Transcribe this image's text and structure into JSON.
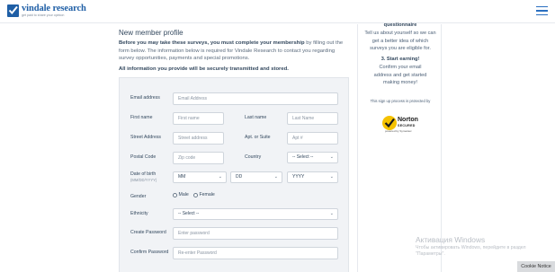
{
  "header": {
    "logo_name": "vindale research",
    "logo_tagline": "get paid to share your opinion"
  },
  "main": {
    "title": "New member profile",
    "intro_bold": "Before you may take these surveys, you must complete your membership",
    "intro_rest": " by filling out the form below. The information below is required for Vindale Research to contact you regarding survey opportunities, payments and special promotions.",
    "secure_note": "All information you provide will be securely transmitted and stored."
  },
  "form": {
    "email_label": "Email address",
    "email_placeholder": "Email Address",
    "first_name_label": "First name",
    "first_name_placeholder": "First name",
    "last_name_label": "Last name",
    "last_name_placeholder": "Last Name",
    "street_label": "Street Address",
    "street_placeholder": "Street address",
    "apt_label": "Apt. or Suite",
    "apt_placeholder": "Apt #",
    "postal_label": "Postal Code",
    "postal_placeholder": "Zip code",
    "country_label": "Country",
    "country_value": "-- Select --",
    "dob_label": "Date of birth",
    "dob_format": "(MM/DD/YYYY)",
    "month_value": "MM",
    "day_value": "DD",
    "year_value": "YYYY",
    "gender_label": "Gender",
    "gender_male": "Male",
    "gender_female": "Female",
    "ethnicity_label": "Ethnicity",
    "ethnicity_value": "-- Select --",
    "password_label": "Create Password",
    "password_placeholder": "Enter password",
    "confirm_label": "Confirm Password",
    "confirm_placeholder": "Re-enter Password"
  },
  "sidebar": {
    "step2_tail": "questionnaire",
    "step2_text": "Tell us about yourself so we can get a better idea of which surveys you are eligible for.",
    "step3_title": "3. Start earning!",
    "step3_text": "Confirm your email address and get started making money!",
    "protected_text": "This sign up process is protected by",
    "norton_brand": "Norton",
    "norton_secured": "SECURED",
    "norton_powered": "powered by Symantec"
  },
  "watermark": {
    "title": "Активация Windows",
    "subtitle": "Чтобы активировать Windows, перейдите в раздел \"Параметры\"."
  },
  "cookie_notice": "Cookie Notice",
  "colors": {
    "brand_blue": "#1f5fa6",
    "panel_bg": "#f1f3f6",
    "norton_yellow": "#f5c200"
  }
}
